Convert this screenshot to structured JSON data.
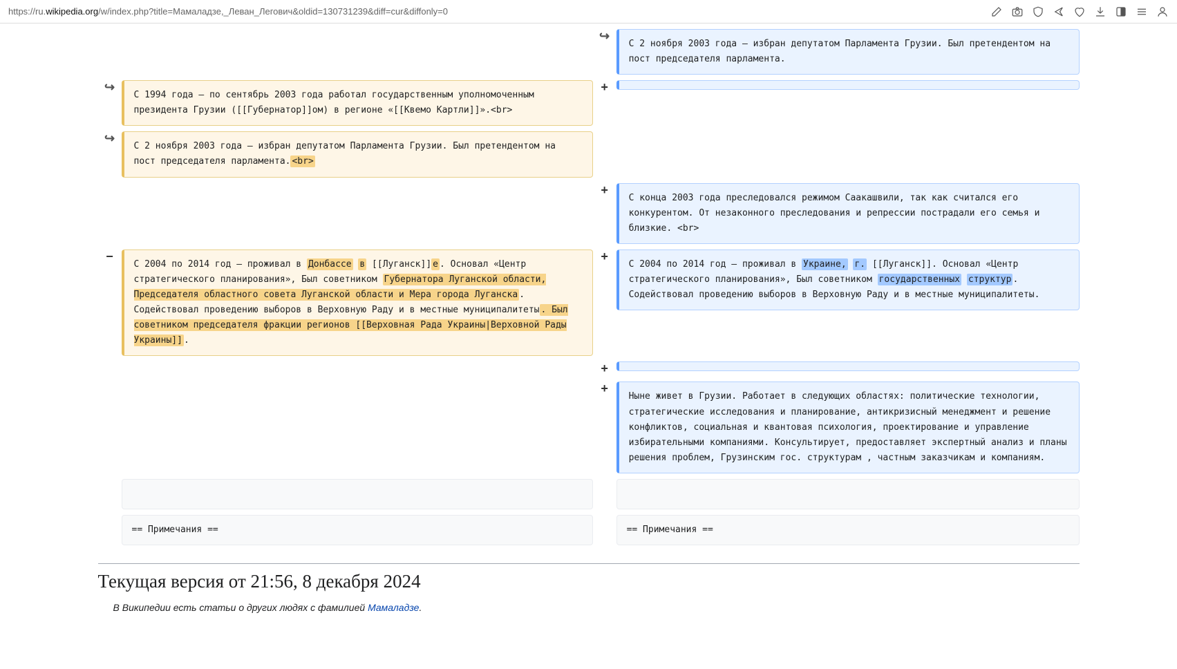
{
  "url": {
    "prefix": "https://ru.",
    "domain": "wikipedia.org",
    "path": "/w/index.php?title=Мамаладзе,_Леван_Легович&oldid=130731239&diff=cur&diffonly=0"
  },
  "markers": {
    "move": "↪",
    "plus": "+",
    "minus": "−"
  },
  "diff": {
    "right_context_1": "С 2 ноября 2003 года — избран депутатом Парламента Грузии. Был претендентом на пост председателя парламента.",
    "left_moved_1": "С 1994 года — по сентябрь 2003 года работал государственным уполномоченным президента Грузии ([[Губернатор]]ом) в регионе «[[Квемо Картли]]».<br>",
    "left_moved_2_pre": "С 2 ноября 2003 года — избран депутатом Парламента Грузии. Был претендентом на пост председателя парламента.",
    "left_moved_2_hl": "<br>",
    "right_add_1": "С конца 2003 года преследовался режимом Саакашвили, так как считался его конкурентом. От незаконного преследования и репрессии пострадали его семья и близкие. <br>",
    "left_change": {
      "p1": "С 2004 по 2014 год — проживал в ",
      "h1": "Донбассе",
      "p1b": " ",
      "h1b": "в",
      "p2": " [[Луганск]]",
      "h2": "е",
      "p3": ". Основал «Центр стратегического планирования», Был советником ",
      "h3": "Губернатора Луганской области, Председателя областного совета Луганской области и Мера города Луганска",
      "p4": ". Содействовал проведению выборов в Верховную Раду и в местные муниципалитеты",
      "h4": ". Был советником председателя фракции регионов [[Верховная Рада Украины|Верховной Рады Украины]]",
      "p5": "."
    },
    "right_change": {
      "p1": "С 2004 по 2014 год — проживал в ",
      "h1": "Украине,",
      "p1b": " ",
      "h1b": "г.",
      "p2": " [[Луганск]]. Основал «Центр стратегического планирования», Был советником ",
      "h2": "государственных",
      "p2b": " ",
      "h2b": "структур",
      "p3": ". Содействовал проведению выборов в Верховную Раду и в местные муниципалитеты."
    },
    "right_add_2": "Ныне живет в Грузии. Работает в следующих областях: политические технологии, стратегические исследования и планирование, антикризисный менеджмент и решение конфликтов, социальная и квантовая психология, проектирование и управление избирательными компаниями. Консультирует, предоставляет экспертный анализ и планы решения проблем, Грузинским гос. структурам , частным заказчикам и  компаниям.",
    "notes_left": "== Примечания ==",
    "notes_right": "== Примечания =="
  },
  "heading": "Текущая версия от 21:56, 8 декабря 2024",
  "hatnote": {
    "pre": "В Википедии есть статьи о других людях с фамилией ",
    "link": "Мамаладзе",
    "post": "."
  }
}
